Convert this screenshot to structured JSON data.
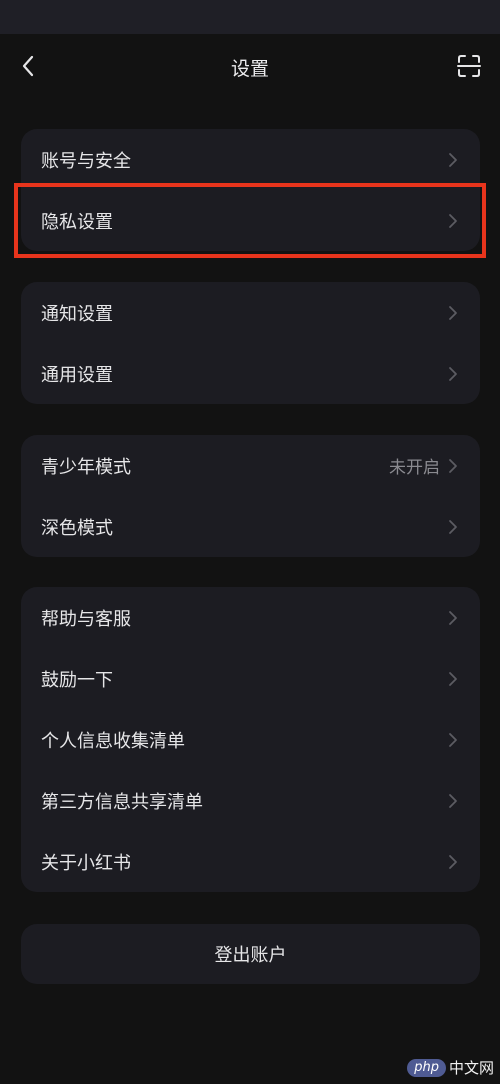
{
  "header": {
    "title": "设置",
    "back_icon": "chevron-left-icon",
    "scan_icon": "scan-icon"
  },
  "groups": [
    {
      "items": [
        {
          "label": "账号与安全",
          "value": ""
        },
        {
          "label": "隐私设置",
          "value": ""
        }
      ]
    },
    {
      "items": [
        {
          "label": "通知设置",
          "value": ""
        },
        {
          "label": "通用设置",
          "value": ""
        }
      ]
    },
    {
      "items": [
        {
          "label": "青少年模式",
          "value": "未开启"
        },
        {
          "label": "深色模式",
          "value": ""
        }
      ]
    },
    {
      "items": [
        {
          "label": "帮助与客服",
          "value": ""
        },
        {
          "label": "鼓励一下",
          "value": ""
        },
        {
          "label": "个人信息收集清单",
          "value": ""
        },
        {
          "label": "第三方信息共享清单",
          "value": ""
        },
        {
          "label": "关于小红书",
          "value": ""
        }
      ]
    }
  ],
  "logout": {
    "label": "登出账户"
  },
  "watermark": {
    "badge": "php",
    "text": "中文网"
  },
  "colors": {
    "background": "#121212",
    "card": "#1c1c22",
    "highlight": "#e8341c",
    "secondary_text": "#8a8a90"
  }
}
